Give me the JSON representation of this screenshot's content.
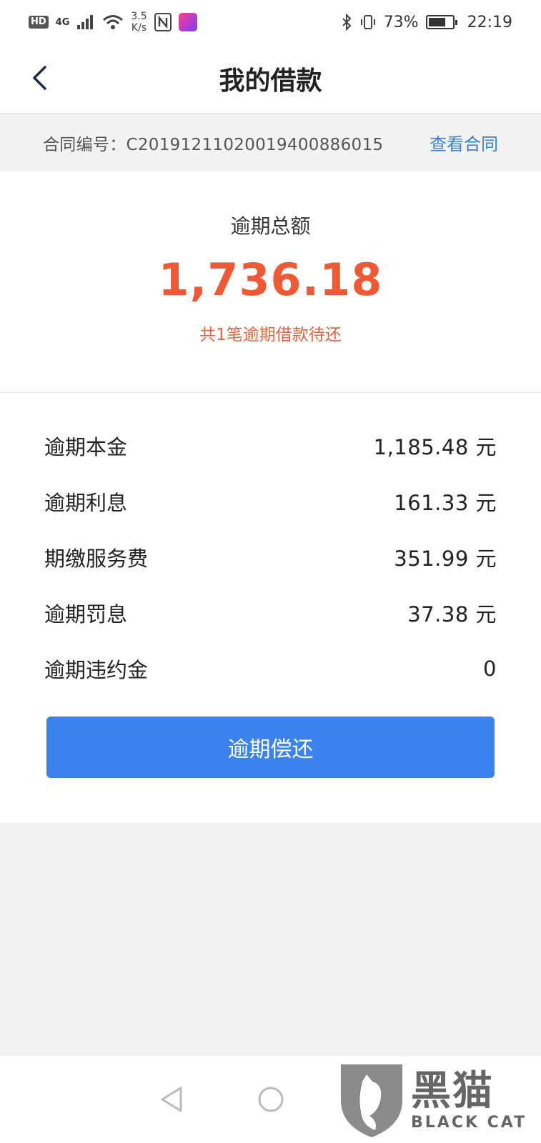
{
  "status_bar": {
    "hd": "HD",
    "network": "4G",
    "speed_value": "3.5",
    "speed_unit": "K/s",
    "battery_percent": "73%",
    "battery_level": 0.73,
    "time": "22:19"
  },
  "header": {
    "title": "我的借款"
  },
  "contract": {
    "label": "合同编号：",
    "number": "C2019121102001940088601 5",
    "view_link": "查看合同"
  },
  "summary": {
    "label": "逾期总额",
    "amount": "1,736.18",
    "note": "共1笔逾期借款待还",
    "color": "#ee5a36"
  },
  "details": [
    {
      "label": "逾期本金",
      "value": "1,185.48 元"
    },
    {
      "label": "逾期利息",
      "value": "161.33 元"
    },
    {
      "label": "期缴服务费",
      "value": "351.99 元"
    },
    {
      "label": "逾期罚息",
      "value": "37.38 元"
    },
    {
      "label": "逾期违约金",
      "value": "0"
    }
  ],
  "actions": {
    "repay_label": "逾期偿还",
    "button_color": "#3b82ef"
  },
  "nav": {
    "icons": [
      "back-triangle-icon",
      "home-circle-icon",
      "recent-square-icon"
    ]
  },
  "watermark": {
    "cn": "黑猫",
    "en": "BLACK CAT"
  }
}
